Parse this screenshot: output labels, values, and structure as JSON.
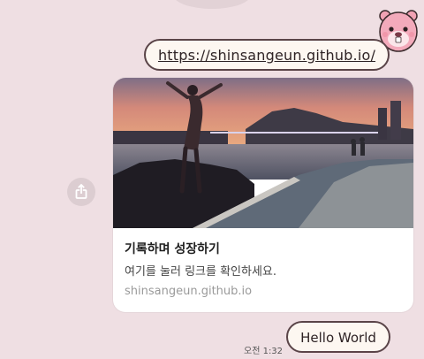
{
  "chat": {
    "link_message": "https://shinsangeun.github.io/",
    "preview": {
      "title": "기록하며 성장하기",
      "description": "여기를 눌러 링크를 확인하세요.",
      "domain": "shinsangeun.github.io"
    },
    "timestamp": "오전 1:32",
    "hello_message": "Hello World"
  },
  "icons": {
    "share": "share-icon",
    "mascot": "beaver-mascot-icon"
  },
  "colors": {
    "background": "#efdfe3",
    "bubble_fill": "#fdf7f1",
    "bubble_border": "#5a4448"
  }
}
